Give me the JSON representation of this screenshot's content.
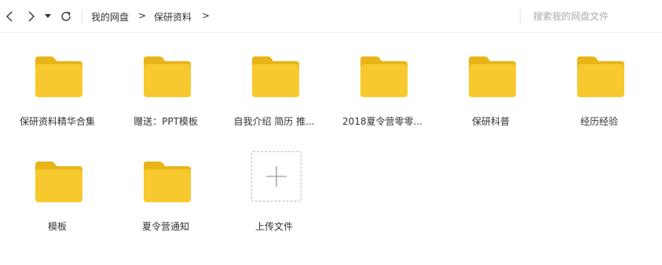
{
  "toolbar": {
    "icons": [
      "back-icon",
      "forward-icon",
      "dropdown-icon",
      "refresh-icon"
    ],
    "breadcrumb": [
      "我的网盘",
      "保研资料"
    ],
    "separator": ">",
    "search_placeholder": "搜索我的网盘文件"
  },
  "items": [
    {
      "label": "保研资料精华合集",
      "type": "folder"
    },
    {
      "label": "赠送：PPT模板",
      "type": "folder"
    },
    {
      "label": "自我介绍 简历 推...",
      "type": "folder"
    },
    {
      "label": "2018夏令营零零...",
      "type": "folder"
    },
    {
      "label": "保研科普",
      "type": "folder"
    },
    {
      "label": "经历经验",
      "type": "folder"
    },
    {
      "label": "模板",
      "type": "folder"
    },
    {
      "label": "夏令营通知",
      "type": "folder"
    }
  ],
  "upload": {
    "label": "上传文件",
    "icon": "plus-icon"
  },
  "colors": {
    "folder": "#F8C92E",
    "folder_tab": "#E8B418",
    "border": "#EEEEEE"
  }
}
